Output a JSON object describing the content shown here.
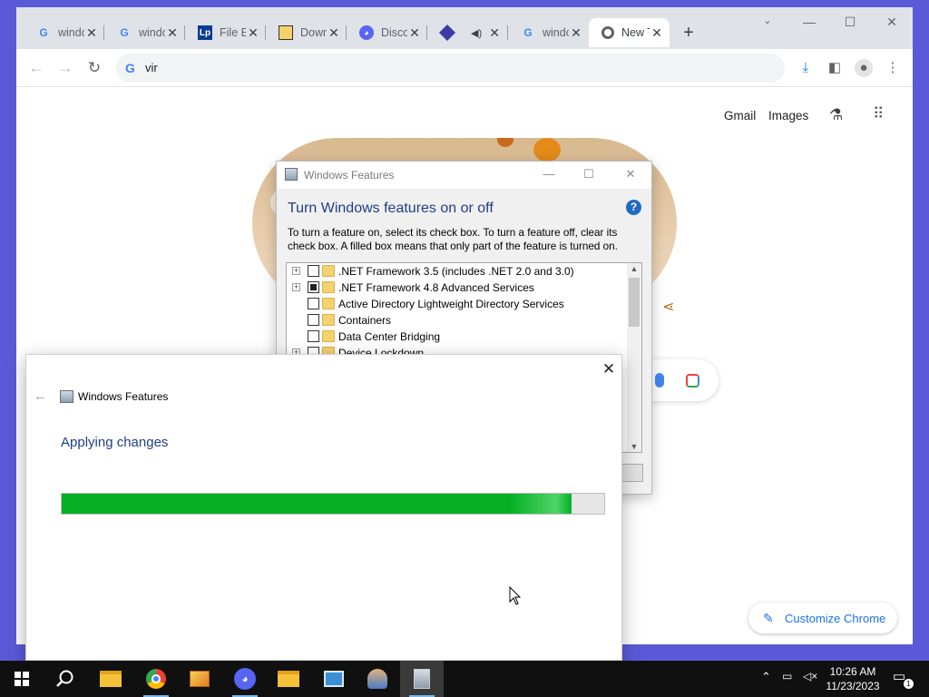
{
  "browser": {
    "tabs": [
      {
        "title": "windows features",
        "favicon": "google-icon",
        "closable": true
      },
      {
        "title": "windows features",
        "favicon": "google-icon",
        "closable": true
      },
      {
        "title": "File Explorer",
        "favicon": "lp-icon",
        "closable": true
      },
      {
        "title": "Downloads",
        "favicon": "folder-image-icon",
        "closable": true
      },
      {
        "title": "Discord",
        "favicon": "discord-icon",
        "closable": true
      },
      {
        "title": "",
        "favicon": "cube-icon",
        "audio": true,
        "closable": true
      },
      {
        "title": "windows features",
        "favicon": "google-icon",
        "closable": true
      },
      {
        "title": "New Tab",
        "favicon": "chrome-icon",
        "closable": true,
        "active": true
      }
    ],
    "omnibox": {
      "value": "vir"
    },
    "ntp": {
      "gmail_label": "Gmail",
      "images_label": "Images",
      "customize_label": "Customize Chrome"
    }
  },
  "features_dialog": {
    "window_title": "Windows Features",
    "heading": "Turn Windows features on or off",
    "help": "?",
    "description": "To turn a feature on, select its check box. To turn a feature off, clear its check box. A filled box means that only part of the feature is turned on.",
    "features": [
      {
        "label": ".NET Framework 3.5 (includes .NET 2.0 and 3.0)",
        "expandable": true,
        "state": "unchecked"
      },
      {
        "label": ".NET Framework 4.8 Advanced Services",
        "expandable": true,
        "state": "partial"
      },
      {
        "label": "Active Directory Lightweight Directory Services",
        "expandable": false,
        "state": "unchecked"
      },
      {
        "label": "Containers",
        "expandable": false,
        "state": "unchecked"
      },
      {
        "label": "Data Center Bridging",
        "expandable": false,
        "state": "unchecked"
      },
      {
        "label": "Device Lockdown",
        "expandable": true,
        "state": "unchecked"
      }
    ]
  },
  "apply_dialog": {
    "window_title": "Windows Features",
    "status": "Applying changes",
    "progress_fraction": 0.94
  },
  "taskbar": {
    "apps": [
      "file-explorer-icon",
      "chrome-icon",
      "photos-icon",
      "discord-icon",
      "folder-icon",
      "control-panel-icon",
      "users-icon",
      "windows-features-icon"
    ],
    "time": "10:26 AM",
    "date": "11/23/2023"
  },
  "colors": {
    "progress_green": "#06b025",
    "dialog_heading": "#1e3f87",
    "chrome_blue": "#1a73e8",
    "desktop": "#5a5ad8"
  }
}
